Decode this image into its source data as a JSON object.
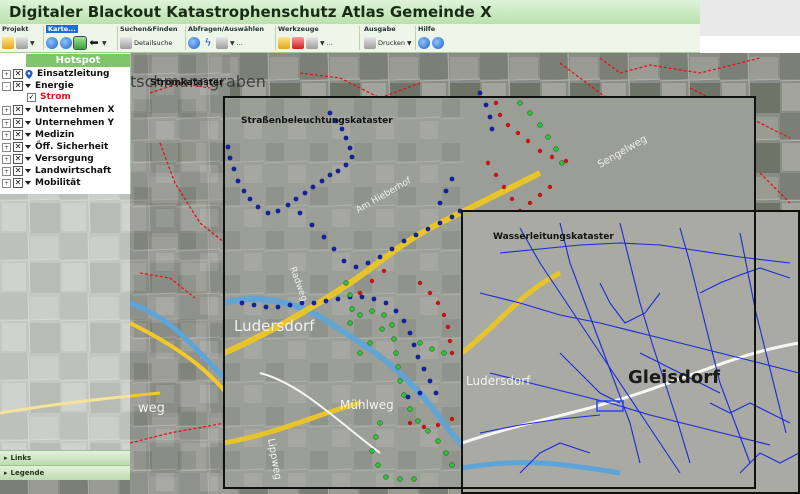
{
  "app": {
    "title": "Digitaler Blackout Katastrophenschutz Atlas Gemeinde X"
  },
  "toolbar": {
    "groups": [
      {
        "label": "Projekt",
        "icons": [
          "folder-open-icon",
          "save-icon"
        ]
      },
      {
        "label": "Karte...",
        "icons": [
          "zoom-in-icon",
          "zoom-out-icon",
          "pan-hand-icon",
          "back-arrow-icon"
        ]
      },
      {
        "label": "Suchen&Finden",
        "button": "Detailsuche"
      },
      {
        "label": "Abfragen/Auswählen",
        "icons": [
          "info-icon",
          "lightning-icon",
          "select-icon"
        ],
        "extra": "..."
      },
      {
        "label": "Werkzeuge",
        "icons": [
          "ruler-icon",
          "chart-icon",
          "pen-icon"
        ],
        "extra": "..."
      },
      {
        "label": "Ausgabe",
        "button": "Drucken"
      },
      {
        "label": "Hilfe",
        "icons": [
          "help-icon",
          "about-icon"
        ]
      }
    ]
  },
  "layers": {
    "header": "Hotspot",
    "items": [
      {
        "label": "Einsatzleitung",
        "expander": "+",
        "checked": true,
        "icon": "location-pin-icon"
      },
      {
        "label": "Energie",
        "expander": "-",
        "checked": true,
        "icon": "dropdown"
      },
      {
        "label": "Strom",
        "sub": true,
        "checked": true,
        "color": "red"
      },
      {
        "label": "Unternehmen X",
        "expander": "+",
        "checked": true,
        "icon": "dropdown"
      },
      {
        "label": "Unternehmen Y",
        "expander": "+",
        "checked": true,
        "icon": "dropdown"
      },
      {
        "label": "Medizin",
        "expander": "+",
        "checked": true,
        "icon": "dropdown"
      },
      {
        "label": "Öff. Sicherheit",
        "expander": "+",
        "checked": true,
        "icon": "dropdown"
      },
      {
        "label": "Versorgung",
        "expander": "+",
        "checked": true,
        "icon": "dropdown"
      },
      {
        "label": "Landwirtschaft",
        "expander": "+",
        "checked": true,
        "icon": "dropdown"
      },
      {
        "label": "Mobilität",
        "expander": "+",
        "checked": true,
        "icon": "dropdown"
      }
    ]
  },
  "panels": {
    "links": "Links",
    "legende": "Legende"
  },
  "map": {
    "places": {
      "top_left": "tschmanngraben",
      "center": "Ludersdorf",
      "center_small": "Ludersdorf",
      "right": "Gleisdorf",
      "street_bottom": "Mühlweg",
      "street_left": "weg",
      "lippweg": "Lippweg"
    },
    "insets": {
      "strom": "Stromkataster",
      "strassen": "Straßenbeleuchtungskataster",
      "wasser": "Wasserleitungskataster"
    },
    "colors": {
      "road": "#f2c928",
      "river": "#5da4d8",
      "power_line": "#e0141b",
      "street_light": "#12239a",
      "green_points": "#2fbf3a",
      "red_points": "#c41414",
      "water": "#1a2ad8"
    }
  }
}
